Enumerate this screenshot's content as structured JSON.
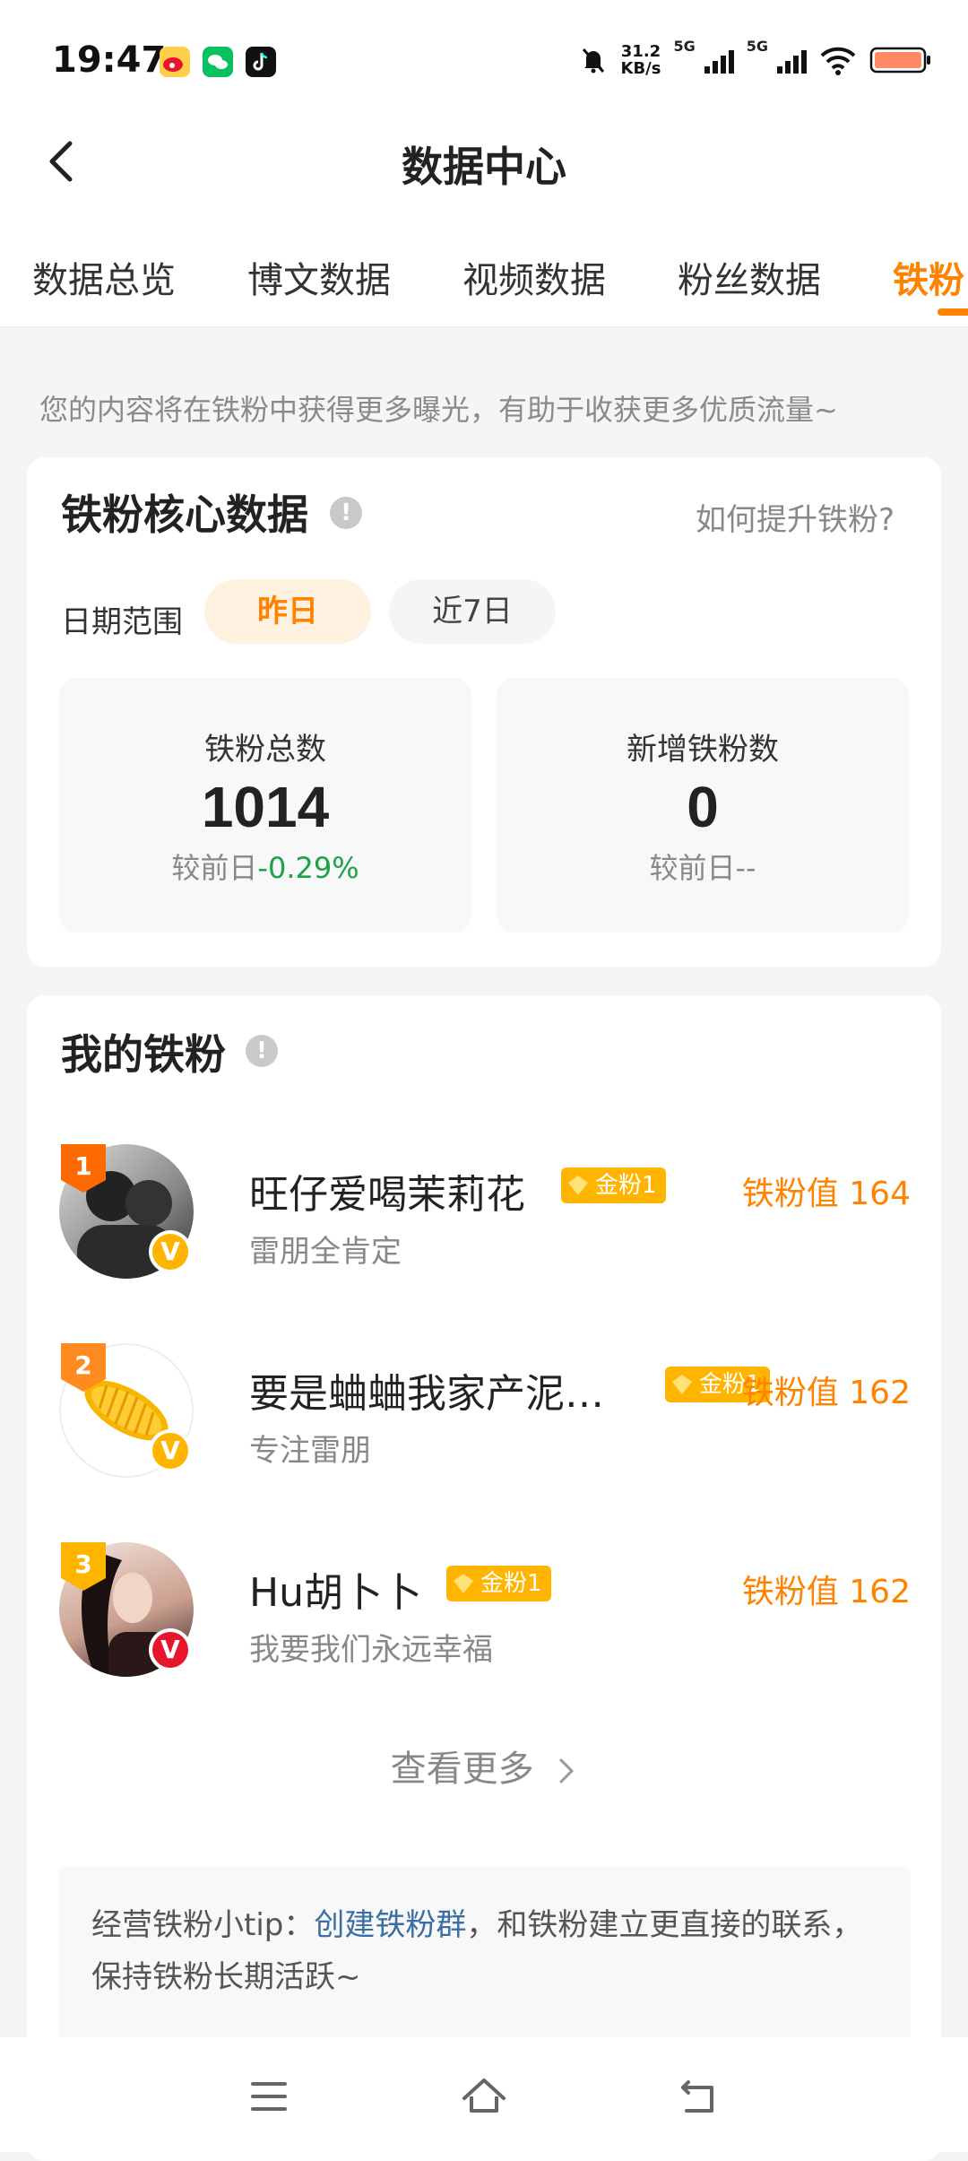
{
  "status": {
    "time": "19:47",
    "speed_value": "31.2",
    "speed_unit": "KB/s",
    "net1": "5G",
    "net2": "5G",
    "colors": {
      "battery": "#ff8a65"
    }
  },
  "header": {
    "title": "数据中心"
  },
  "tabs": [
    "数据总览",
    "博文数据",
    "视频数据",
    "粉丝数据",
    "铁粉"
  ],
  "notice": "您的内容将在铁粉中获得更多曝光，有助于收获更多优质流量~",
  "core": {
    "title": "铁粉核心数据",
    "info_icon": "!",
    "how_link": "如何提升铁粉?",
    "date_label": "日期范围",
    "range_options": [
      "昨日",
      "近7日"
    ],
    "selected_range": "昨日",
    "total": {
      "label": "铁粉总数",
      "value": "1014",
      "cmp_prefix": "较前日",
      "cmp_value": "-0.29%"
    },
    "new": {
      "label": "新增铁粉数",
      "value": "0",
      "cmp_prefix": "较前日",
      "cmp_value": "--"
    }
  },
  "fans": {
    "title": "我的铁粉",
    "info_icon": "!",
    "items": [
      {
        "rank": "1",
        "name": "旺仔爱喝茉莉花",
        "badge": "金粉1",
        "sub": "雷朋全肯定",
        "value": "铁粉值 164",
        "verify": "V"
      },
      {
        "rank": "2",
        "name": "要是蛐蛐我家产泥…",
        "badge": "金粉1",
        "sub": "专注雷朋",
        "value": "铁粉值 162",
        "verify": "V"
      },
      {
        "rank": "3",
        "name": "Hu胡卜卜",
        "badge": "金粉1",
        "sub": "我要我们永远幸福",
        "value": "铁粉值 162",
        "verify": "V"
      }
    ],
    "more_label": "查看更多"
  },
  "tip": {
    "prefix": "经营铁粉小tip：",
    "link": "创建铁粉群",
    "suffix": "，和铁粉建立更直接的联系，保持铁粉长期活跃~"
  },
  "accent": "#ff8200",
  "icons": [
    "back-icon",
    "info-icon",
    "chevron-right-icon",
    "menu-icon",
    "home-icon",
    "return-icon"
  ]
}
